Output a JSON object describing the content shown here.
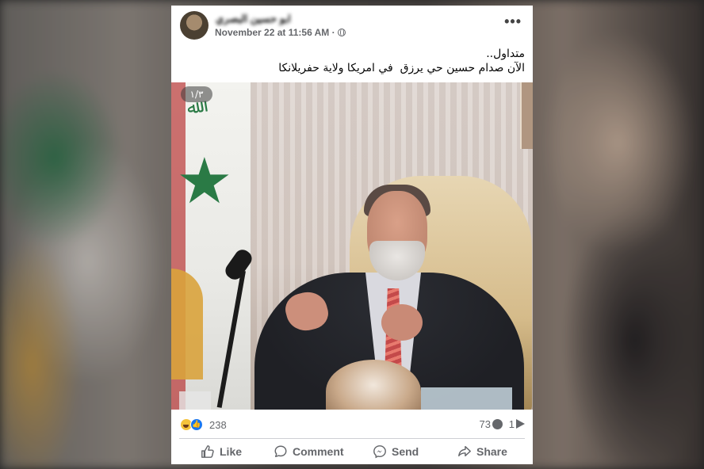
{
  "post": {
    "author_name": "ابو حسين البصري",
    "timestamp": "November 22 at 11:56 AM ·",
    "text_lines": [
      "متداول..",
      "الآن صدام حسين حي يرزق  في امريكا ولاية حفريلانكا"
    ],
    "media": {
      "slide_counter": "١/٣"
    },
    "stats": {
      "reactions_count": "238",
      "comments_count": "73",
      "shares_count": "1"
    },
    "actions": {
      "like": "Like",
      "comment": "Comment",
      "send": "Send",
      "share": "Share"
    }
  },
  "colors": {
    "accent": "#1877f2",
    "secondary_text": "#65676b"
  },
  "icons": [
    "more-icon",
    "globe-icon",
    "haha-icon",
    "like-icon",
    "comment-bubble-icon",
    "share-arrow-icon",
    "like-button-icon",
    "comment-button-icon",
    "messenger-icon",
    "share-button-icon"
  ]
}
